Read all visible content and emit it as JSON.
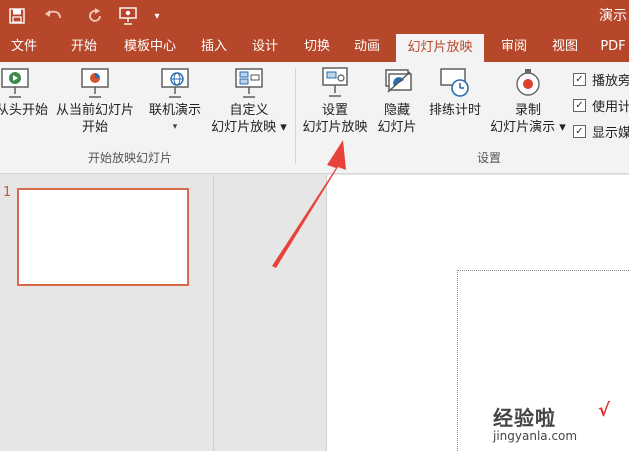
{
  "titlebar": {
    "title": "演示",
    "quick_access": [
      "save-icon",
      "undo-icon",
      "redo-icon",
      "presenter-icon",
      "customize-icon"
    ]
  },
  "tabs": [
    {
      "label": "文件"
    },
    {
      "label": "开始"
    },
    {
      "label": "模板中心"
    },
    {
      "label": "插入"
    },
    {
      "label": "设计"
    },
    {
      "label": "切换"
    },
    {
      "label": "动画"
    },
    {
      "label": "幻灯片放映",
      "active": true
    },
    {
      "label": "审阅"
    },
    {
      "label": "视图"
    },
    {
      "label": "PDF"
    }
  ],
  "ribbon": {
    "group_start": {
      "label": "开始放映幻灯片",
      "from_beginning": {
        "line1": "从头开始"
      },
      "from_current": {
        "line1": "从当前幻灯片",
        "line2": "开始"
      },
      "online": {
        "line1": "联机演示",
        "line2": "▾"
      },
      "custom": {
        "line1": "自定义",
        "line2": "幻灯片放映 ▾"
      }
    },
    "group_setup": {
      "label": "设置",
      "setup_show": {
        "line1": "设置",
        "line2": "幻灯片放映"
      },
      "hide_slide": {
        "line1": "隐藏",
        "line2": "幻灯片"
      },
      "rehearse": {
        "line1": "排练计时"
      },
      "record": {
        "line1": "录制",
        "line2": "幻灯片演示 ▾"
      }
    },
    "checkboxes": [
      {
        "label": "播放旁",
        "checked": true
      },
      {
        "label": "使用计",
        "checked": true
      },
      {
        "label": "显示媒",
        "checked": true
      }
    ]
  },
  "slides": [
    {
      "number": "1"
    }
  ],
  "watermark": {
    "main": "经验啦",
    "sub": "jingyanla.com"
  },
  "colors": {
    "accent": "#b7472a",
    "annotation_arrow": "#e8433a"
  }
}
